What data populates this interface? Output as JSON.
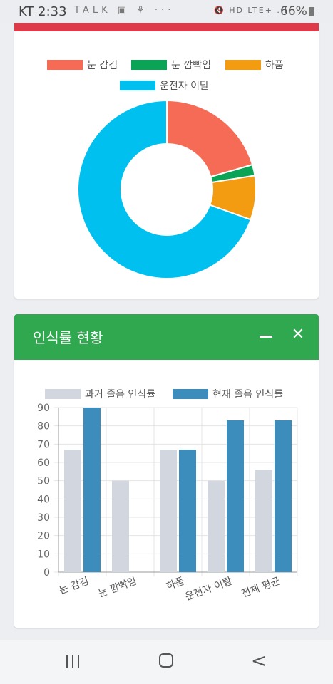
{
  "status_bar": {
    "carrier_time": "KT 2:33",
    "left_icons": "TALK ▣ ⚘ ···",
    "right_icons": "🔇 HD LTE+ .ıl",
    "battery": "66%"
  },
  "pie_card": {
    "legend": [
      {
        "label": "눈 감김",
        "color": "#f56b55"
      },
      {
        "label": "눈 깜빡임",
        "color": "#0ba456"
      },
      {
        "label": "하품",
        "color": "#f39c12"
      },
      {
        "label": "운전자 이탈",
        "color": "#00c0ef"
      }
    ],
    "chart_data": {
      "type": "pie",
      "donut": true,
      "labels": [
        "눈 감김",
        "눈 깜빡임",
        "하품",
        "운전자 이탈"
      ],
      "values": [
        20.5,
        2,
        8,
        69.5
      ],
      "colors": [
        "#f56b55",
        "#0ba456",
        "#f39c12",
        "#00c0ef"
      ],
      "legend": "top"
    }
  },
  "bar_card": {
    "title": "인식률 현황",
    "minimize_icon": "minus-icon",
    "close_icon": "close-icon",
    "legend": [
      {
        "label": "과거 졸음 인식률",
        "color": "#d2d6de"
      },
      {
        "label": "현재 졸음 인식률",
        "color": "#3c8dbc"
      }
    ],
    "chart_data": {
      "type": "bar",
      "categories": [
        "눈 감김",
        "눈 깜빡임",
        "하품",
        "운전자 이탈",
        "전체 평균"
      ],
      "series": [
        {
          "name": "과거 졸음 인식률",
          "values": [
            67,
            50,
            67,
            50,
            56
          ],
          "color": "#d2d6de"
        },
        {
          "name": "현재 졸음 인식률",
          "values": [
            90,
            0,
            67,
            83,
            83
          ],
          "color": "#3c8dbc"
        }
      ],
      "ylim": [
        0,
        90
      ],
      "yticks": [
        0,
        10,
        20,
        30,
        40,
        50,
        60,
        70,
        80,
        90
      ],
      "grid": true,
      "legend": "top"
    }
  },
  "nav_bar": {
    "recent": "recent-apps-icon",
    "home": "home-icon",
    "back": "back-icon"
  }
}
